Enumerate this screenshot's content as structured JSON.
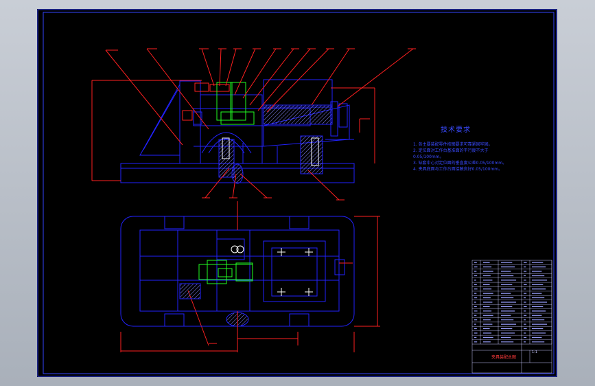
{
  "drawing": {
    "tech_requirements": {
      "title": "技术要求",
      "lines": [
        "1. 各主要装配零件按图要求可靠紧固牢固。",
        "2. 定位面对工作台基准面的平行度不大于",
        "   0.05/100mm。",
        "3. 钻套中心对定位面的垂直度公差0.05/100mm。",
        "4. 夹具底面与工作台面接触良好0.05/100mm。"
      ]
    },
    "title_block": {
      "name": "夹具装配总图",
      "scale": "1:1"
    }
  },
  "colors": {
    "frame": "#3344ff",
    "part": "#2222ff",
    "dimension": "#ff2020",
    "highlight": "#22ff22",
    "hatch": "#8888ff",
    "text": "#3a4bff"
  }
}
